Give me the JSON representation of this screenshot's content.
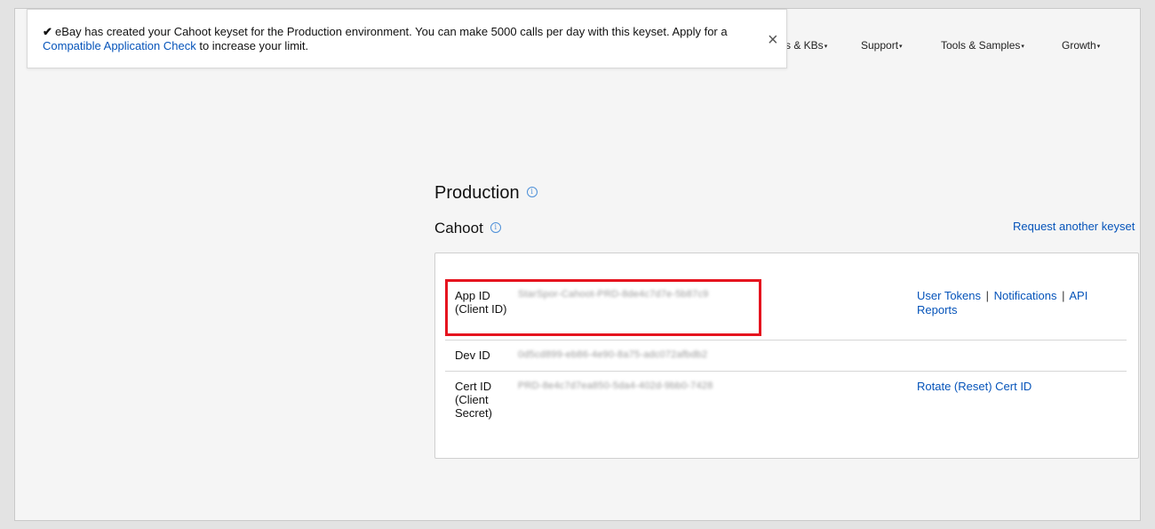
{
  "nav": {
    "items": [
      {
        "label": "s & KBs"
      },
      {
        "label": "Support"
      },
      {
        "label": "Tools & Samples"
      },
      {
        "label": "Growth"
      }
    ],
    "caret": "▾"
  },
  "toast": {
    "check": "✔",
    "message_before": "eBay has created your Cahoot keyset for the Production environment. You can make 5000 calls per day with this keyset. Apply for a ",
    "link_text": "Compatible Application Check",
    "message_after": " to increase your limit.",
    "close_glyph": "×"
  },
  "section": {
    "title": "Production",
    "info": "i"
  },
  "keyset": {
    "name": "Cahoot",
    "info": "i",
    "request_link": "Request another keyset"
  },
  "rows": [
    {
      "label": "App ID (Client ID)",
      "value": "StarSpor-Cahoot-PRD-8de4c7d7e-5b87c9",
      "actions": {
        "link1": "User Tokens",
        "sep": "|",
        "link2": "Notifications",
        "link3": "API Reports"
      }
    },
    {
      "label": "Dev ID",
      "value": "0d5cd899-eb86-4e90-8a75-adc072afbdb2"
    },
    {
      "label": "Cert ID (Client Secret)",
      "value": "PRD-8e4c7d7ea850-5da4-402d-9bb0-7428",
      "action": "Rotate (Reset) Cert ID"
    }
  ],
  "colors": {
    "link": "#0654ba",
    "highlight": "#e5141f",
    "info_icon": "#4c8fd8"
  }
}
